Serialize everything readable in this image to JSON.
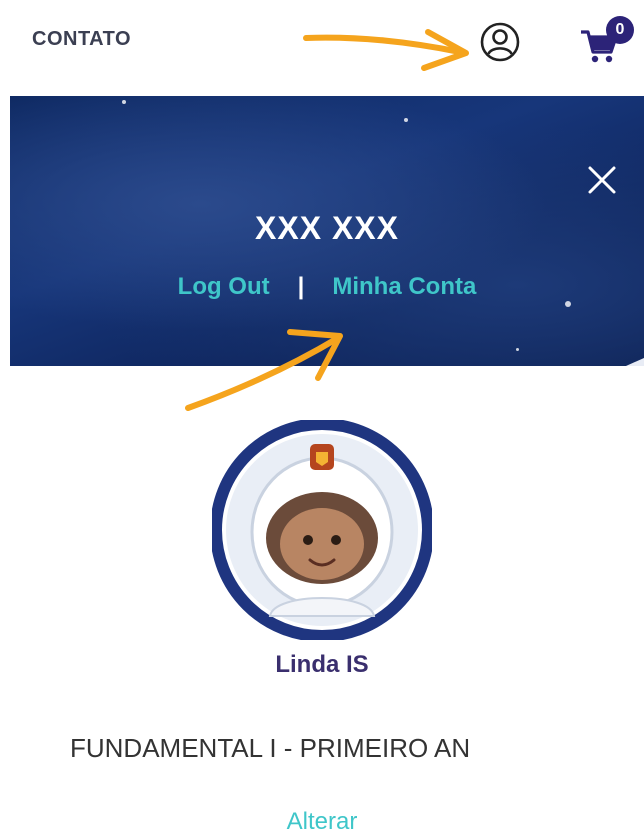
{
  "header": {
    "nav_contact": "CONTATO",
    "cart_count": "0",
    "user_icon": "user-circle-icon",
    "cart_icon": "shopping-cart-icon"
  },
  "account_panel": {
    "user_name": "XXX XXX",
    "logout_label": "Log Out",
    "separator": "|",
    "my_account_label": "Minha Conta",
    "close_icon": "close-icon"
  },
  "profile": {
    "avatar_icon": "astronaut-avatar-icon",
    "name": "Linda IS",
    "grade": "FUNDAMENTAL I - PRIMEIRO AN",
    "change_label": "Alterar"
  },
  "colors": {
    "accent": "#3fc6c9",
    "annotation_arrow": "#f5a41d",
    "badge": "#2c2378",
    "banner": "#14306e"
  }
}
